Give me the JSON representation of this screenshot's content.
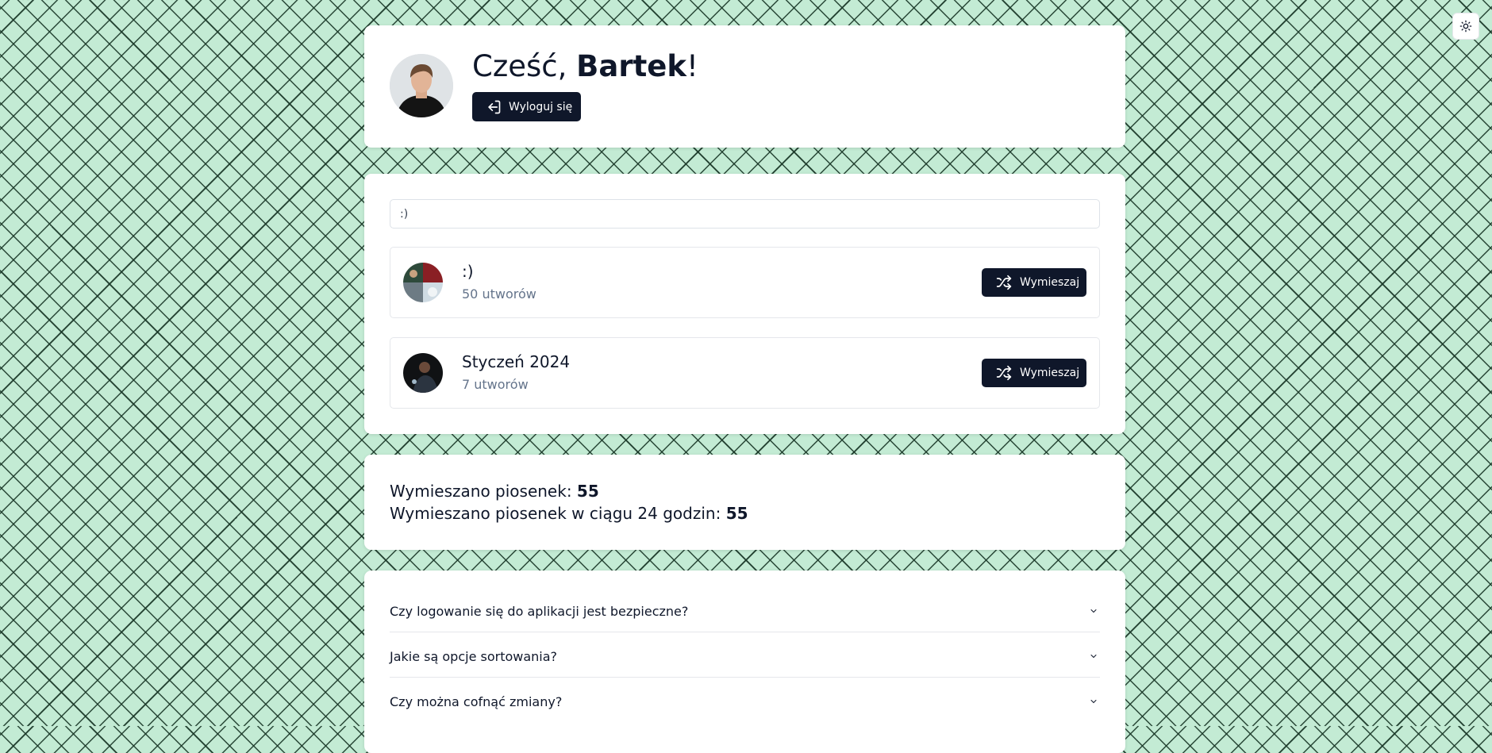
{
  "header": {
    "greeting_prefix": "Cześć, ",
    "user_name": "Bartek",
    "greeting_suffix": "!",
    "logout_label": "Wyloguj się"
  },
  "search": {
    "value": ":)"
  },
  "playlists": [
    {
      "name": ":)",
      "count": "50 utworów",
      "action_label": "Wymieszaj"
    },
    {
      "name": "Styczeń 2024",
      "count": "7 utworów",
      "action_label": "Wymieszaj"
    }
  ],
  "stats": {
    "total_label": "Wymieszano piosenek: ",
    "total_value": "55",
    "day_label": "Wymieszano piosenek w ciągu 24 godzin: ",
    "day_value": "55"
  },
  "faq": [
    {
      "question": "Czy logowanie się do aplikacji jest bezpieczne?"
    },
    {
      "question": "Jakie są opcje sortowania?"
    },
    {
      "question": "Czy można cofnąć zmiany?"
    }
  ],
  "icons": {
    "theme_toggle": "sun-icon",
    "logout": "log-in-icon",
    "shuffle": "shuffle-icon",
    "faq_toggle": "chevron-down-icon"
  },
  "colors": {
    "background": "#c3ebd4",
    "pattern_lines": "#1c3a2a",
    "button_dark": "#0f172a",
    "muted_text": "#64748b"
  }
}
